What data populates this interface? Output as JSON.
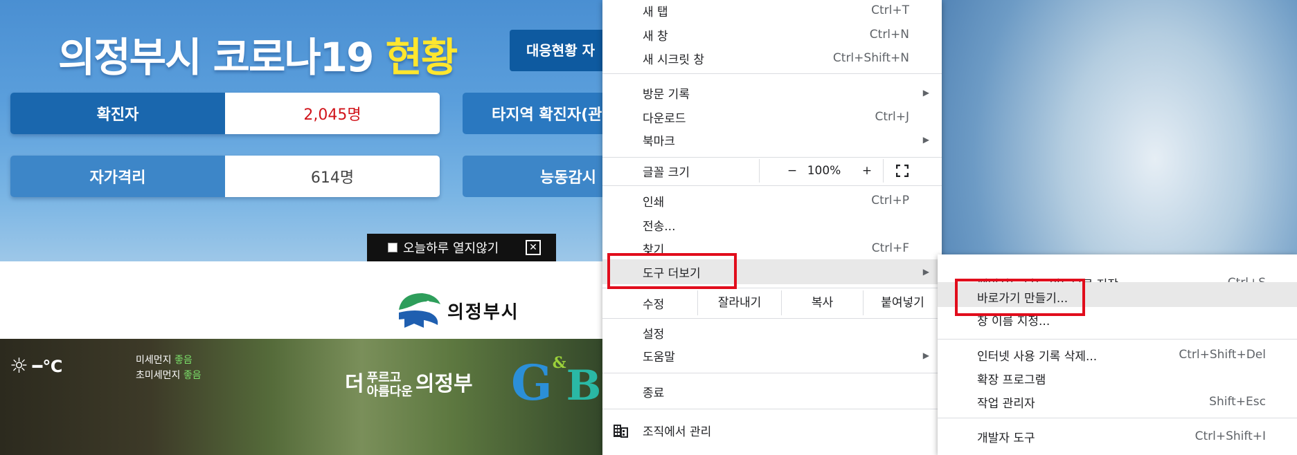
{
  "website": {
    "title_main": "의정부시 코로나19 ",
    "title_highlight": "현황",
    "response_button": "대응현황 자",
    "stats": [
      {
        "label": "확진자",
        "value": "2,045명"
      },
      {
        "label": "자가격리",
        "value": "614명"
      }
    ],
    "stats_right": [
      "타지역 확진자(관",
      "능동감시"
    ],
    "popup_dismiss_label": "오늘하루 열지않기",
    "popup_close": "✕",
    "city_name": "의정부시",
    "weather_temp": "━℃",
    "dust_label": "미세먼지",
    "dust_value": "좋음",
    "fine_dust_label": "초미세먼지",
    "fine_dust_value": "좋음",
    "slogan_small_top": "푸르고",
    "slogan_small_bottom": "아름다운",
    "slogan_prefix": "더",
    "slogan_main": "의정부",
    "gb_logo_g": "G",
    "gb_logo_amp": "&",
    "gb_logo_b": "B"
  },
  "main_menu": {
    "new_tab": {
      "label": "새 탭",
      "shortcut": "Ctrl+T"
    },
    "new_window": {
      "label": "새 창",
      "shortcut": "Ctrl+N"
    },
    "incognito": {
      "label": "새 시크릿 창",
      "shortcut": "Ctrl+Shift+N"
    },
    "history": {
      "label": "방문 기록"
    },
    "downloads": {
      "label": "다운로드",
      "shortcut": "Ctrl+J"
    },
    "bookmarks": {
      "label": "북마크"
    },
    "zoom": {
      "label": "글꼴 크기",
      "minus": "−",
      "level": "100%",
      "plus": "+"
    },
    "print": {
      "label": "인쇄",
      "shortcut": "Ctrl+P"
    },
    "cast": {
      "label": "전송..."
    },
    "find": {
      "label": "찾기",
      "shortcut": "Ctrl+F"
    },
    "more_tools": {
      "label": "도구 더보기"
    },
    "edit": {
      "label": "수정",
      "cut": "잘라내기",
      "copy": "복사",
      "paste": "붙여넣기"
    },
    "settings": {
      "label": "설정"
    },
    "help": {
      "label": "도움말"
    },
    "exit": {
      "label": "종료"
    },
    "managed": {
      "label": "조직에서 관리"
    }
  },
  "sub_menu": {
    "save_page": {
      "label": "페이지를 다른 이름으로 저장...",
      "shortcut": "Ctrl+S"
    },
    "create_shortcut": {
      "label": "바로가기 만들기..."
    },
    "name_window": {
      "label": "창 이름 지정..."
    },
    "clear_data": {
      "label": "인터넷 사용 기록 삭제...",
      "shortcut": "Ctrl+Shift+Del"
    },
    "extensions": {
      "label": "확장 프로그램"
    },
    "task_manager": {
      "label": "작업 관리자",
      "shortcut": "Shift+Esc"
    },
    "dev_tools": {
      "label": "개발자 도구",
      "shortcut": "Ctrl+Shift+I"
    }
  },
  "colors": {
    "highlight_box": "#e10d1c",
    "banner_blue": "#1a67ae",
    "confirmed_red": "#d1141b",
    "title_yellow": "#ffe62e"
  }
}
